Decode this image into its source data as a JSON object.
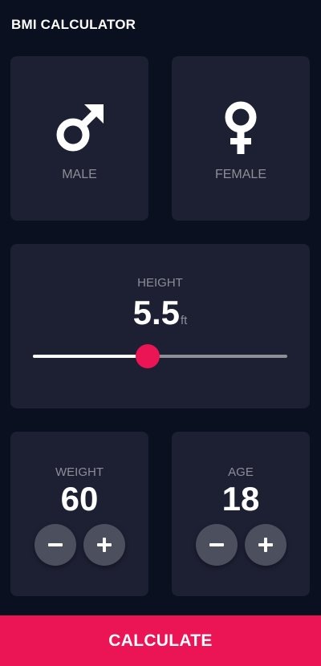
{
  "appbar": {
    "title": "BMI CALCULATOR"
  },
  "gender": {
    "male": {
      "label": "MALE",
      "icon": "male-symbol-icon"
    },
    "female": {
      "label": "FEMALE",
      "icon": "female-symbol-icon"
    }
  },
  "height": {
    "label": "HEIGHT",
    "value": "5.5",
    "unit": "ft",
    "slider_fraction": 0.45
  },
  "weight": {
    "label": "WEIGHT",
    "value": "60"
  },
  "age": {
    "label": "AGE",
    "value": "18"
  },
  "calculate": {
    "label": "CALCULATE"
  },
  "colors": {
    "background": "#0b1020",
    "card": "#1d1f33",
    "accent": "#eb1555",
    "muted_text": "#8d8e98",
    "button": "#4c4f5e"
  }
}
